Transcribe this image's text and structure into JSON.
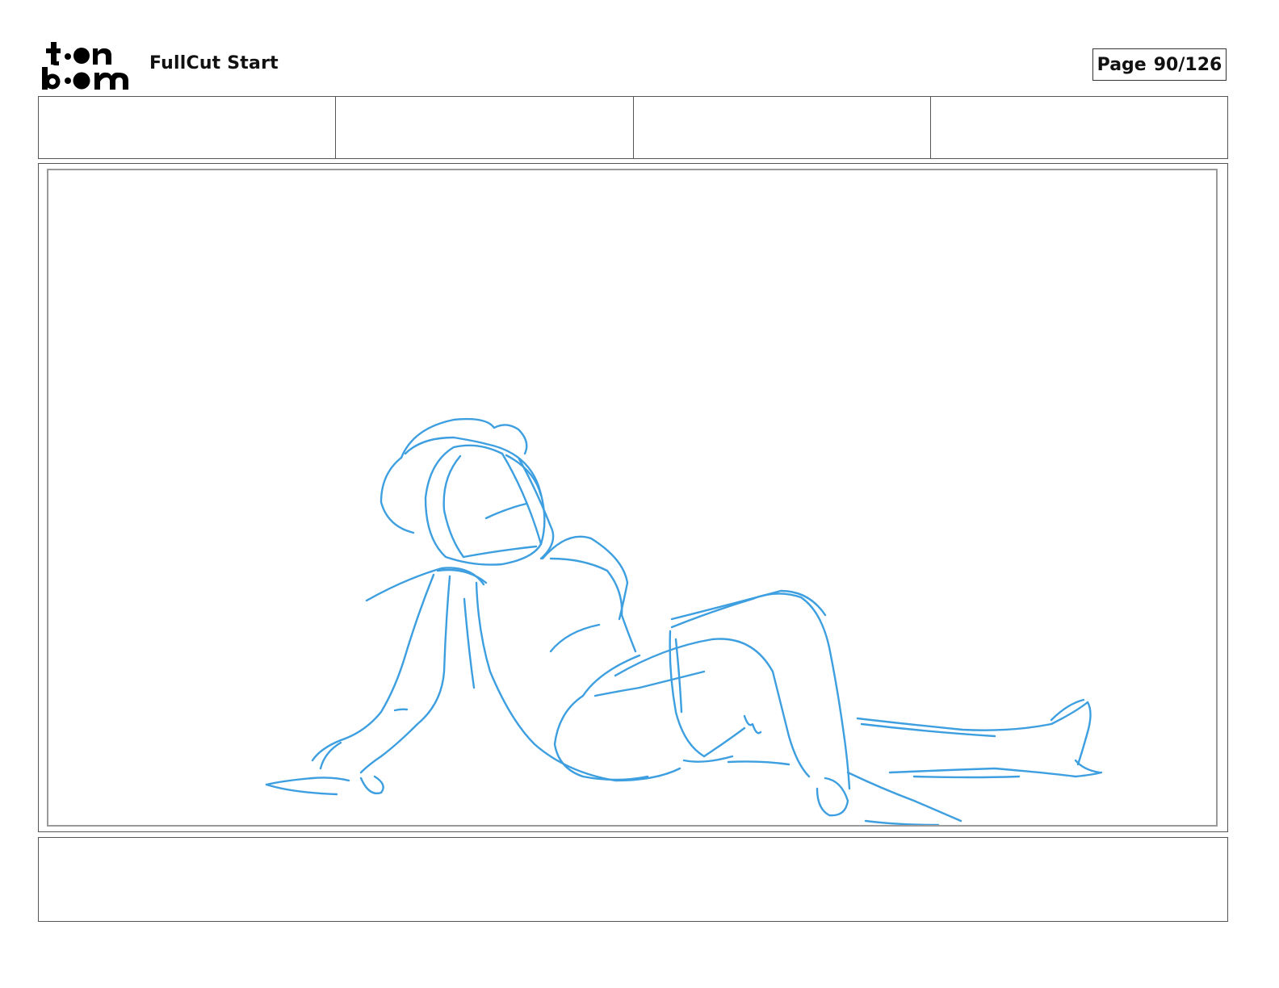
{
  "header": {
    "logo_text": "toonboom",
    "document_title": "FullCut Start",
    "page_label": "Page",
    "page_number": "90/126"
  },
  "panel_fields": [
    "",
    "",
    "",
    ""
  ],
  "notes": "",
  "colors": {
    "sketch_stroke": "#3d9fe0",
    "frame_border": "#555555",
    "safe_area_border": "#9a9a9a"
  }
}
